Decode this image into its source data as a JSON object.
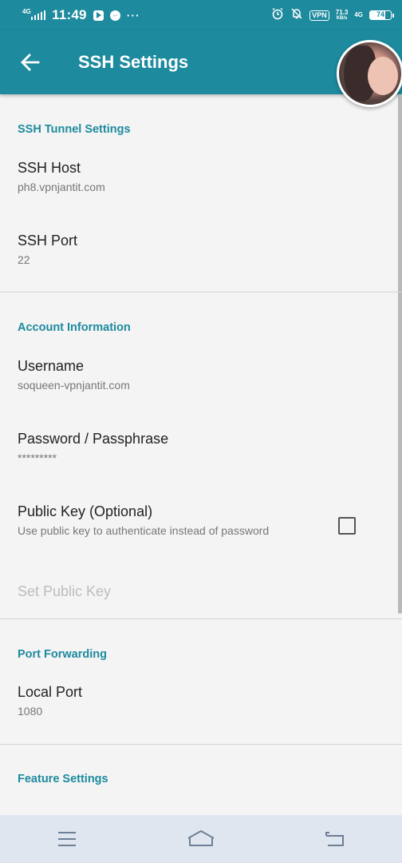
{
  "status_bar": {
    "network_left": "4G",
    "time": "11:49",
    "more": "···",
    "vpn": "VPN",
    "speed_value": "71.3",
    "speed_unit": "KB/s",
    "network_right": "4G",
    "battery_level": "74",
    "battery_fraction": 0.74
  },
  "app_bar": {
    "title": "SSH Settings",
    "back_icon": "arrow-left-icon"
  },
  "sections": {
    "tunnel": {
      "header": "SSH Tunnel Settings",
      "host": {
        "title": "SSH Host",
        "value": "ph8.vpnjantit.com"
      },
      "port": {
        "title": "SSH Port",
        "value": "22"
      }
    },
    "account": {
      "header": "Account Information",
      "username": {
        "title": "Username",
        "value": "soqueen-vpnjantit.com"
      },
      "password": {
        "title": "Password / Passphrase",
        "value": "*********"
      },
      "public_key": {
        "title": "Public Key (Optional)",
        "summary": "Use public key to authenticate instead of password",
        "checked": false
      },
      "set_public_key": {
        "title": "Set Public Key"
      }
    },
    "forwarding": {
      "header": "Port Forwarding",
      "local_port": {
        "title": "Local Port",
        "value": "1080"
      }
    },
    "feature": {
      "header": "Feature Settings"
    }
  },
  "nav_bar": {
    "menu_icon": "menu-icon",
    "home_icon": "home-icon",
    "back_icon": "back-icon"
  },
  "colors": {
    "accent": "#1d8a9e",
    "background": "#f4f4f4",
    "nav_bar": "#dfe6f0"
  }
}
